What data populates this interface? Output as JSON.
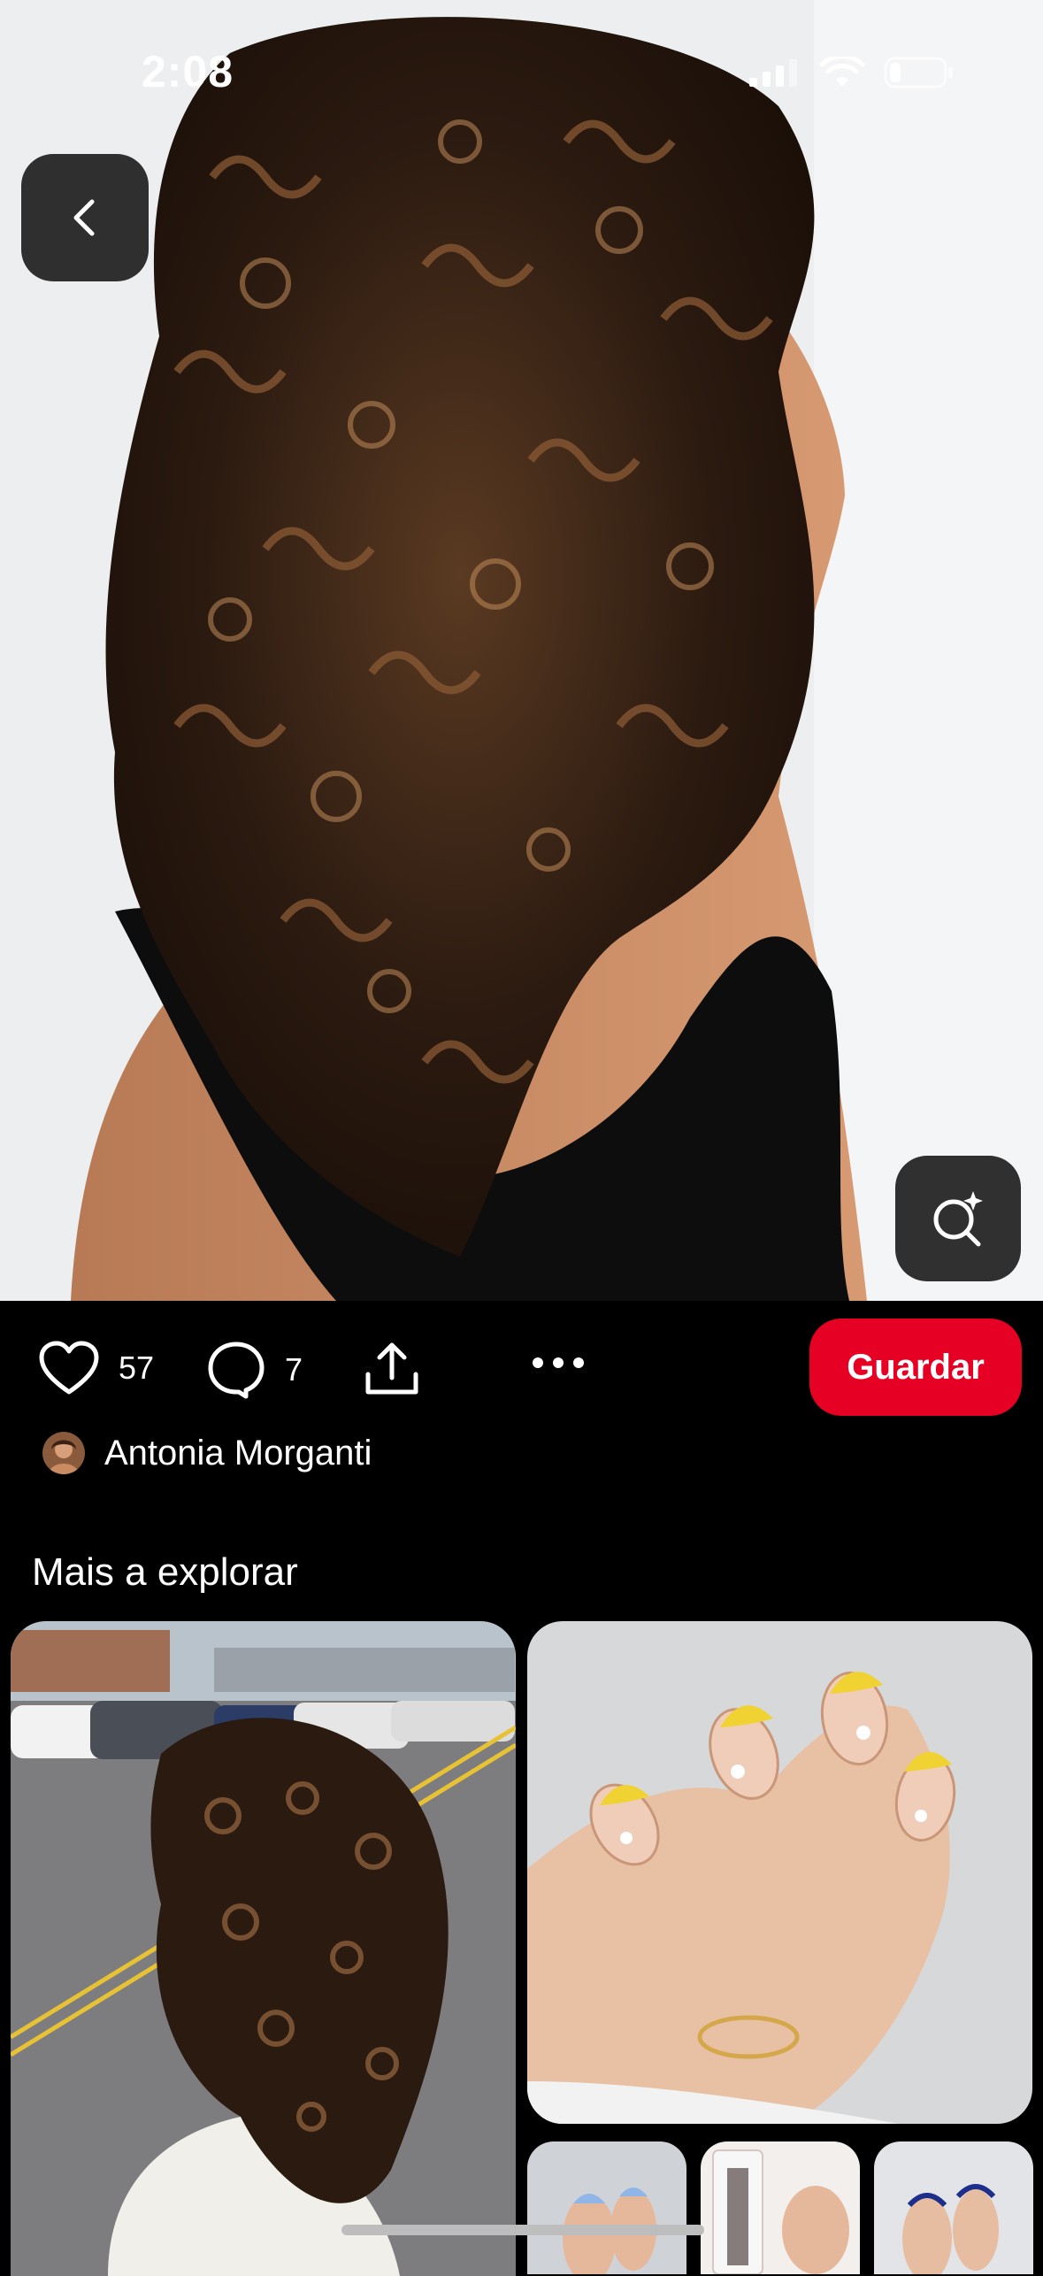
{
  "status_bar": {
    "time": "2:08"
  },
  "pin": {
    "likes": "57",
    "comments": "7",
    "save_label": "Guardar",
    "author": "Antonia Morganti"
  },
  "explore": {
    "title": "Mais a explorar"
  },
  "colors": {
    "save": "#e60023",
    "background": "#000000"
  },
  "icons": [
    "back-icon",
    "visual-search-icon",
    "heart-icon",
    "comment-icon",
    "share-icon",
    "more-icon"
  ]
}
